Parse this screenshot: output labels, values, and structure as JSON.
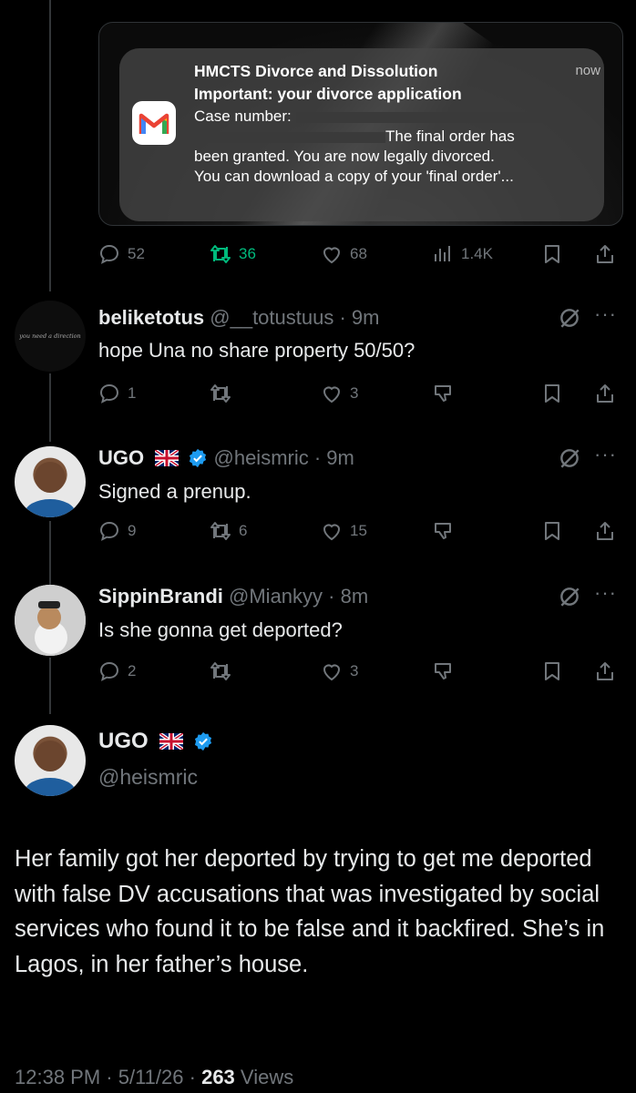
{
  "notification": {
    "app": "gmail-icon",
    "time": "now",
    "sender": "HMCTS Divorce and Dissolution",
    "subject": "Important: your divorce application",
    "line1": "Case number: ",
    "line2": "The final order has",
    "line3": "been granted. You are now legally divorced.",
    "line4": "You can download a copy of your 'final order'..."
  },
  "original_tweet": {
    "replies": "52",
    "reposts": "36",
    "likes": "68",
    "views": "1.4K"
  },
  "replies": [
    {
      "name": "beliketotus",
      "handle": "@__totustuus",
      "time": "9m",
      "text": "hope Una no share property 50/50?",
      "avatar_text": "you need a direction",
      "reply_count": "1",
      "repost_count": "",
      "like_count": "3"
    },
    {
      "name": "UGO",
      "flag": "uk-flag",
      "handle": "@heismric",
      "time": "9m",
      "text": "Signed a prenup.",
      "reply_count": "9",
      "repost_count": "6",
      "like_count": "15"
    },
    {
      "name": "SippinBrandi",
      "handle": "@Miankyy",
      "time": "8m",
      "text": "Is she gonna get deported?",
      "reply_count": "2",
      "repost_count": "",
      "like_count": "3"
    }
  ],
  "main_post": {
    "name": "UGO",
    "flag": "uk-flag",
    "handle": "@heismric",
    "text": "Her family got her deported by trying to get me deported with false DV accusations that was investigated by social services who found it to be false and it backfired. She’s in Lagos, in her father’s house.",
    "time": "12:38 PM",
    "date": "5/11/26",
    "views_count": "263",
    "views_label": "Views"
  },
  "colors": {
    "background": "#000000",
    "text": "#e7e9ea",
    "muted": "#71767b",
    "repost_active": "#00ba7c",
    "verified": "#1d9bf0"
  }
}
